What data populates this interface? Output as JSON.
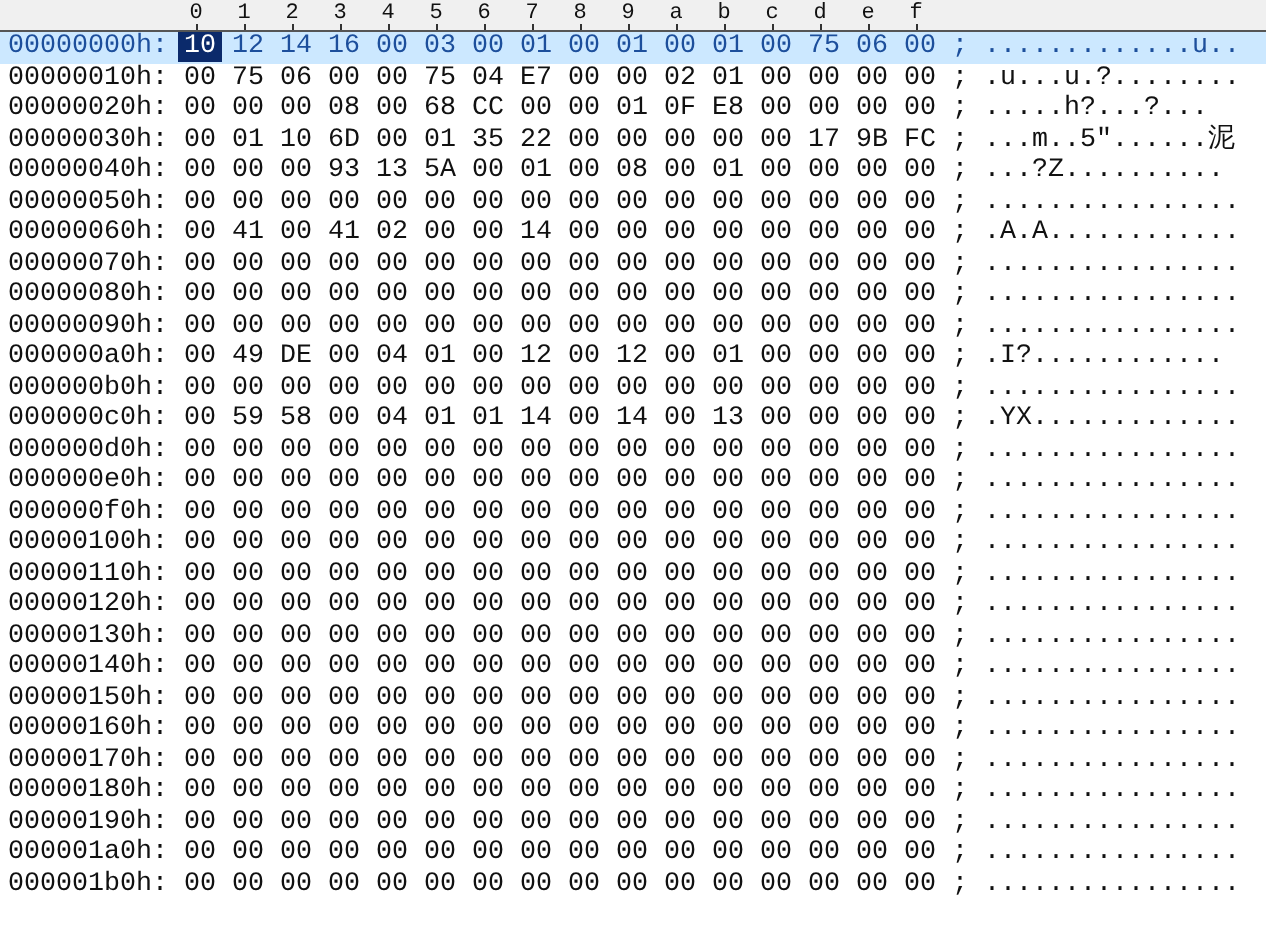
{
  "columns": [
    "0",
    "1",
    "2",
    "3",
    "4",
    "5",
    "6",
    "7",
    "8",
    "9",
    "a",
    "b",
    "c",
    "d",
    "e",
    "f"
  ],
  "rows": [
    {
      "address": "00000000h:",
      "bytes": [
        "10",
        "12",
        "14",
        "16",
        "00",
        "03",
        "00",
        "01",
        "00",
        "01",
        "00",
        "01",
        "00",
        "75",
        "06",
        "00"
      ],
      "separator": ";",
      "ascii": ".............u..",
      "selected": true,
      "caret": true
    },
    {
      "address": "00000010h:",
      "bytes": [
        "00",
        "75",
        "06",
        "00",
        "00",
        "75",
        "04",
        "E7",
        "00",
        "00",
        "02",
        "01",
        "00",
        "00",
        "00",
        "00"
      ],
      "separator": ";",
      "ascii": ".u...u.?........",
      "selected": false,
      "caret": false
    },
    {
      "address": "00000020h:",
      "bytes": [
        "00",
        "00",
        "00",
        "08",
        "00",
        "68",
        "CC",
        "00",
        "00",
        "01",
        "0F",
        "E8",
        "00",
        "00",
        "00",
        "00"
      ],
      "separator": ";",
      "ascii": ".....h?...?...",
      "selected": false,
      "caret": false
    },
    {
      "address": "00000030h:",
      "bytes": [
        "00",
        "01",
        "10",
        "6D",
        "00",
        "01",
        "35",
        "22",
        "00",
        "00",
        "00",
        "00",
        "00",
        "17",
        "9B",
        "FC"
      ],
      "separator": ";",
      "ascii": "...m..5\"......泥",
      "selected": false,
      "caret": false
    },
    {
      "address": "00000040h:",
      "bytes": [
        "00",
        "00",
        "00",
        "93",
        "13",
        "5A",
        "00",
        "01",
        "00",
        "08",
        "00",
        "01",
        "00",
        "00",
        "00",
        "00"
      ],
      "separator": ";",
      "ascii": "...?Z..........",
      "selected": false,
      "caret": false
    },
    {
      "address": "00000050h:",
      "bytes": [
        "00",
        "00",
        "00",
        "00",
        "00",
        "00",
        "00",
        "00",
        "00",
        "00",
        "00",
        "00",
        "00",
        "00",
        "00",
        "00"
      ],
      "separator": ";",
      "ascii": "................",
      "selected": false,
      "caret": false
    },
    {
      "address": "00000060h:",
      "bytes": [
        "00",
        "41",
        "00",
        "41",
        "02",
        "00",
        "00",
        "14",
        "00",
        "00",
        "00",
        "00",
        "00",
        "00",
        "00",
        "00"
      ],
      "separator": ";",
      "ascii": ".A.A............",
      "selected": false,
      "caret": false
    },
    {
      "address": "00000070h:",
      "bytes": [
        "00",
        "00",
        "00",
        "00",
        "00",
        "00",
        "00",
        "00",
        "00",
        "00",
        "00",
        "00",
        "00",
        "00",
        "00",
        "00"
      ],
      "separator": ";",
      "ascii": "................",
      "selected": false,
      "caret": false
    },
    {
      "address": "00000080h:",
      "bytes": [
        "00",
        "00",
        "00",
        "00",
        "00",
        "00",
        "00",
        "00",
        "00",
        "00",
        "00",
        "00",
        "00",
        "00",
        "00",
        "00"
      ],
      "separator": ";",
      "ascii": "................",
      "selected": false,
      "caret": false
    },
    {
      "address": "00000090h:",
      "bytes": [
        "00",
        "00",
        "00",
        "00",
        "00",
        "00",
        "00",
        "00",
        "00",
        "00",
        "00",
        "00",
        "00",
        "00",
        "00",
        "00"
      ],
      "separator": ";",
      "ascii": "................",
      "selected": false,
      "caret": false
    },
    {
      "address": "000000a0h:",
      "bytes": [
        "00",
        "49",
        "DE",
        "00",
        "04",
        "01",
        "00",
        "12",
        "00",
        "12",
        "00",
        "01",
        "00",
        "00",
        "00",
        "00"
      ],
      "separator": ";",
      "ascii": ".I?............",
      "selected": false,
      "caret": false
    },
    {
      "address": "000000b0h:",
      "bytes": [
        "00",
        "00",
        "00",
        "00",
        "00",
        "00",
        "00",
        "00",
        "00",
        "00",
        "00",
        "00",
        "00",
        "00",
        "00",
        "00"
      ],
      "separator": ";",
      "ascii": "................",
      "selected": false,
      "caret": false
    },
    {
      "address": "000000c0h:",
      "bytes": [
        "00",
        "59",
        "58",
        "00",
        "04",
        "01",
        "01",
        "14",
        "00",
        "14",
        "00",
        "13",
        "00",
        "00",
        "00",
        "00"
      ],
      "separator": ";",
      "ascii": ".YX.............",
      "selected": false,
      "caret": false
    },
    {
      "address": "000000d0h:",
      "bytes": [
        "00",
        "00",
        "00",
        "00",
        "00",
        "00",
        "00",
        "00",
        "00",
        "00",
        "00",
        "00",
        "00",
        "00",
        "00",
        "00"
      ],
      "separator": ";",
      "ascii": "................",
      "selected": false,
      "caret": false
    },
    {
      "address": "000000e0h:",
      "bytes": [
        "00",
        "00",
        "00",
        "00",
        "00",
        "00",
        "00",
        "00",
        "00",
        "00",
        "00",
        "00",
        "00",
        "00",
        "00",
        "00"
      ],
      "separator": ";",
      "ascii": "................",
      "selected": false,
      "caret": false
    },
    {
      "address": "000000f0h:",
      "bytes": [
        "00",
        "00",
        "00",
        "00",
        "00",
        "00",
        "00",
        "00",
        "00",
        "00",
        "00",
        "00",
        "00",
        "00",
        "00",
        "00"
      ],
      "separator": ";",
      "ascii": "................",
      "selected": false,
      "caret": false
    },
    {
      "address": "00000100h:",
      "bytes": [
        "00",
        "00",
        "00",
        "00",
        "00",
        "00",
        "00",
        "00",
        "00",
        "00",
        "00",
        "00",
        "00",
        "00",
        "00",
        "00"
      ],
      "separator": ";",
      "ascii": "................",
      "selected": false,
      "caret": false
    },
    {
      "address": "00000110h:",
      "bytes": [
        "00",
        "00",
        "00",
        "00",
        "00",
        "00",
        "00",
        "00",
        "00",
        "00",
        "00",
        "00",
        "00",
        "00",
        "00",
        "00"
      ],
      "separator": ";",
      "ascii": "................",
      "selected": false,
      "caret": false
    },
    {
      "address": "00000120h:",
      "bytes": [
        "00",
        "00",
        "00",
        "00",
        "00",
        "00",
        "00",
        "00",
        "00",
        "00",
        "00",
        "00",
        "00",
        "00",
        "00",
        "00"
      ],
      "separator": ";",
      "ascii": "................",
      "selected": false,
      "caret": false
    },
    {
      "address": "00000130h:",
      "bytes": [
        "00",
        "00",
        "00",
        "00",
        "00",
        "00",
        "00",
        "00",
        "00",
        "00",
        "00",
        "00",
        "00",
        "00",
        "00",
        "00"
      ],
      "separator": ";",
      "ascii": "................",
      "selected": false,
      "caret": false
    },
    {
      "address": "00000140h:",
      "bytes": [
        "00",
        "00",
        "00",
        "00",
        "00",
        "00",
        "00",
        "00",
        "00",
        "00",
        "00",
        "00",
        "00",
        "00",
        "00",
        "00"
      ],
      "separator": ";",
      "ascii": "................",
      "selected": false,
      "caret": false
    },
    {
      "address": "00000150h:",
      "bytes": [
        "00",
        "00",
        "00",
        "00",
        "00",
        "00",
        "00",
        "00",
        "00",
        "00",
        "00",
        "00",
        "00",
        "00",
        "00",
        "00"
      ],
      "separator": ";",
      "ascii": "................",
      "selected": false,
      "caret": false
    },
    {
      "address": "00000160h:",
      "bytes": [
        "00",
        "00",
        "00",
        "00",
        "00",
        "00",
        "00",
        "00",
        "00",
        "00",
        "00",
        "00",
        "00",
        "00",
        "00",
        "00"
      ],
      "separator": ";",
      "ascii": "................",
      "selected": false,
      "caret": false
    },
    {
      "address": "00000170h:",
      "bytes": [
        "00",
        "00",
        "00",
        "00",
        "00",
        "00",
        "00",
        "00",
        "00",
        "00",
        "00",
        "00",
        "00",
        "00",
        "00",
        "00"
      ],
      "separator": ";",
      "ascii": "................",
      "selected": false,
      "caret": false
    },
    {
      "address": "00000180h:",
      "bytes": [
        "00",
        "00",
        "00",
        "00",
        "00",
        "00",
        "00",
        "00",
        "00",
        "00",
        "00",
        "00",
        "00",
        "00",
        "00",
        "00"
      ],
      "separator": ";",
      "ascii": "................",
      "selected": false,
      "caret": false
    },
    {
      "address": "00000190h:",
      "bytes": [
        "00",
        "00",
        "00",
        "00",
        "00",
        "00",
        "00",
        "00",
        "00",
        "00",
        "00",
        "00",
        "00",
        "00",
        "00",
        "00"
      ],
      "separator": ";",
      "ascii": "................",
      "selected": false,
      "caret": false
    },
    {
      "address": "000001a0h:",
      "bytes": [
        "00",
        "00",
        "00",
        "00",
        "00",
        "00",
        "00",
        "00",
        "00",
        "00",
        "00",
        "00",
        "00",
        "00",
        "00",
        "00"
      ],
      "separator": ";",
      "ascii": "................",
      "selected": false,
      "caret": false
    },
    {
      "address": "000001b0h:",
      "bytes": [
        "00",
        "00",
        "00",
        "00",
        "00",
        "00",
        "00",
        "00",
        "00",
        "00",
        "00",
        "00",
        "00",
        "00",
        "00",
        "00"
      ],
      "separator": ";",
      "ascii": "................",
      "selected": false,
      "caret": false
    }
  ]
}
